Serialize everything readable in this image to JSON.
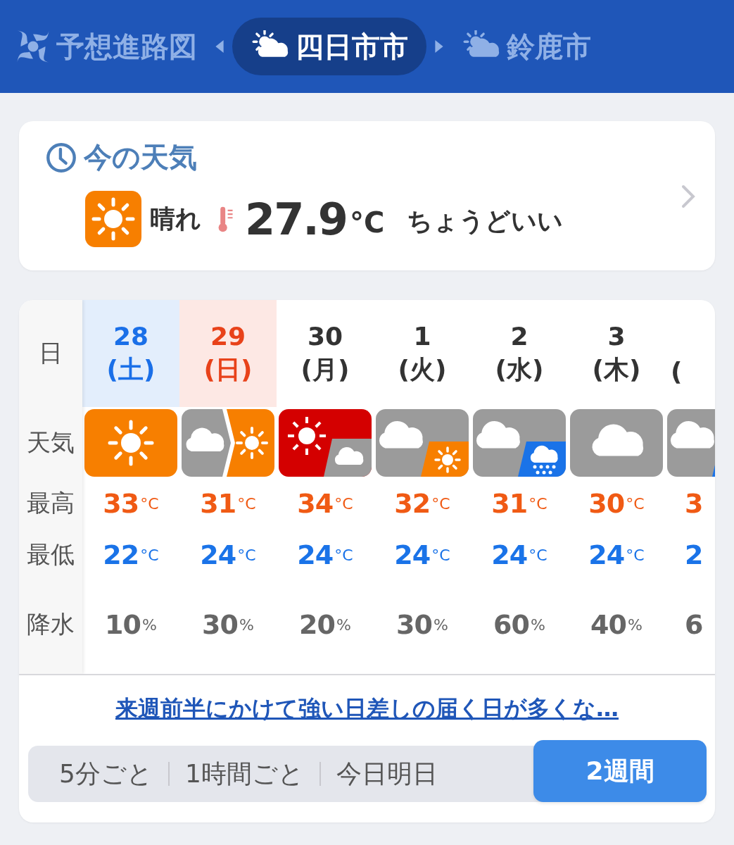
{
  "header_tabs": [
    {
      "kind": "typhoon",
      "label": "予想進路図",
      "selected": false
    },
    {
      "kind": "partly_sunny",
      "label": "四日市市",
      "selected": true
    },
    {
      "kind": "partly_sunny",
      "label": "鈴鹿市",
      "selected": false
    }
  ],
  "current": {
    "title": "今の天気",
    "condition": "晴れ",
    "temperature": "27.9",
    "unit": "°C",
    "feeling": "ちょうどいい"
  },
  "forecast": {
    "row_labels": [
      "日",
      "天気",
      "最高",
      "最低",
      "降水"
    ],
    "days": [
      {
        "date": "28",
        "weekday": "(土)",
        "kind": "saturday",
        "weather": {
          "kind": "sunny"
        },
        "high": {
          "value": "33",
          "unit": "°C"
        },
        "low": {
          "value": "22",
          "unit": "°C"
        },
        "rain": {
          "value": "10",
          "unit": "%"
        },
        "cut": false
      },
      {
        "date": "29",
        "weekday": "(日)",
        "kind": "sunday",
        "weather": {
          "kind": "cloudy_then_sunny"
        },
        "high": {
          "value": "31",
          "unit": "°C"
        },
        "low": {
          "value": "24",
          "unit": "°C"
        },
        "rain": {
          "value": "30",
          "unit": "%"
        },
        "cut": false
      },
      {
        "date": "30",
        "weekday": "(月)",
        "kind": "weekday",
        "weather": {
          "kind": "heat_sometimes_cloudy"
        },
        "high": {
          "value": "34",
          "unit": "°C"
        },
        "low": {
          "value": "24",
          "unit": "°C"
        },
        "rain": {
          "value": "20",
          "unit": "%"
        },
        "cut": false
      },
      {
        "date": "1",
        "weekday": "(火)",
        "kind": "weekday",
        "weather": {
          "kind": "cloudy_sometimes_sunny"
        },
        "high": {
          "value": "32",
          "unit": "°C"
        },
        "low": {
          "value": "24",
          "unit": "°C"
        },
        "rain": {
          "value": "30",
          "unit": "%"
        },
        "cut": false
      },
      {
        "date": "2",
        "weekday": "(水)",
        "kind": "weekday",
        "weather": {
          "kind": "cloudy_sometimes_rain"
        },
        "high": {
          "value": "31",
          "unit": "°C"
        },
        "low": {
          "value": "24",
          "unit": "°C"
        },
        "rain": {
          "value": "60",
          "unit": "%"
        },
        "cut": false
      },
      {
        "date": "3",
        "weekday": "(木)",
        "kind": "weekday",
        "weather": {
          "kind": "cloudy"
        },
        "high": {
          "value": "30",
          "unit": "°C"
        },
        "low": {
          "value": "24",
          "unit": "°C"
        },
        "rain": {
          "value": "40",
          "unit": "%"
        },
        "cut": false
      },
      {
        "weekday": "(",
        "kind": "weekday",
        "weather": {
          "kind": "cloudy_sometimes_rain"
        },
        "high": {
          "value": "3"
        },
        "low": {
          "value": "2"
        },
        "rain": {
          "value": "6"
        },
        "cut": true
      }
    ]
  },
  "comment_link": "来週前半にかけて強い日差しの届く日が多くな…",
  "range_tabs": [
    {
      "label": "5分ごと",
      "selected": false
    },
    {
      "label": "1時間ごと",
      "selected": false
    },
    {
      "label": "今日明日",
      "selected": false
    },
    {
      "label": "2週間",
      "selected": true
    }
  ]
}
